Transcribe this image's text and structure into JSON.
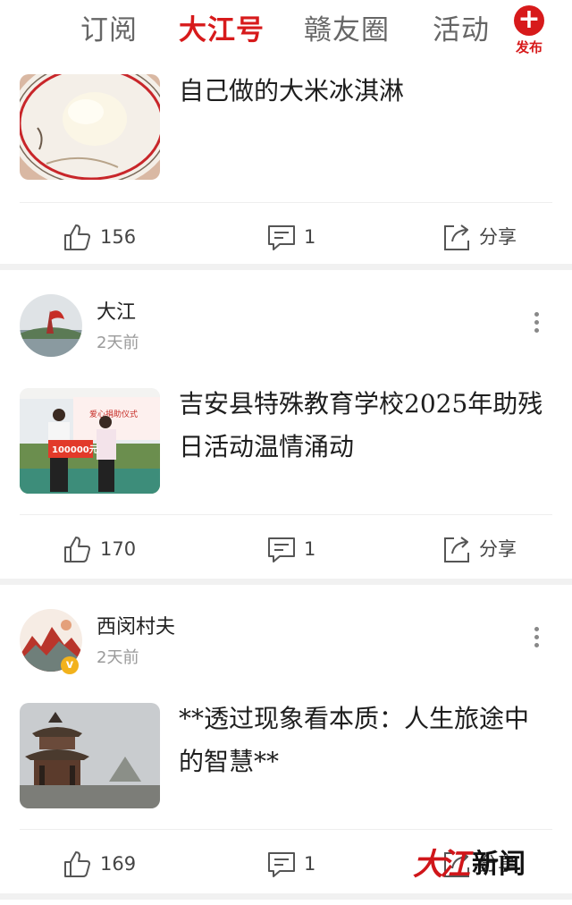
{
  "tabs": [
    {
      "label": "订阅",
      "active": false
    },
    {
      "label": "大江号",
      "active": true
    },
    {
      "label": "赣友圈",
      "active": false
    },
    {
      "label": "活动",
      "active": false
    }
  ],
  "publish": {
    "label": "发布",
    "icon": "plus-icon"
  },
  "accent_color": "#d71a1b",
  "posts": [
    {
      "title": "自己做的大米冰淇淋",
      "thumbnail": "ice-cream-photo",
      "likes": "156",
      "comments": "1",
      "share_label": "分享"
    },
    {
      "author": "大江",
      "time": "2天前",
      "title": "吉安县特殊教育学校2025年助残日活动温情涌动",
      "thumbnail": "donation-ceremony-photo",
      "photo_text": {
        "banner": "爱心捐助仪式",
        "board": "100000元"
      },
      "likes": "170",
      "comments": "1",
      "share_label": "分享"
    },
    {
      "author": "西闵村夫",
      "time": "2天前",
      "title": "**透过现象看本质：人生旅途中的智慧**",
      "thumbnail": "pavilion-photo",
      "likes": "169",
      "comments": "1",
      "share_label": "分享"
    }
  ],
  "watermark": {
    "logo": "大江",
    "text": "新闻"
  }
}
